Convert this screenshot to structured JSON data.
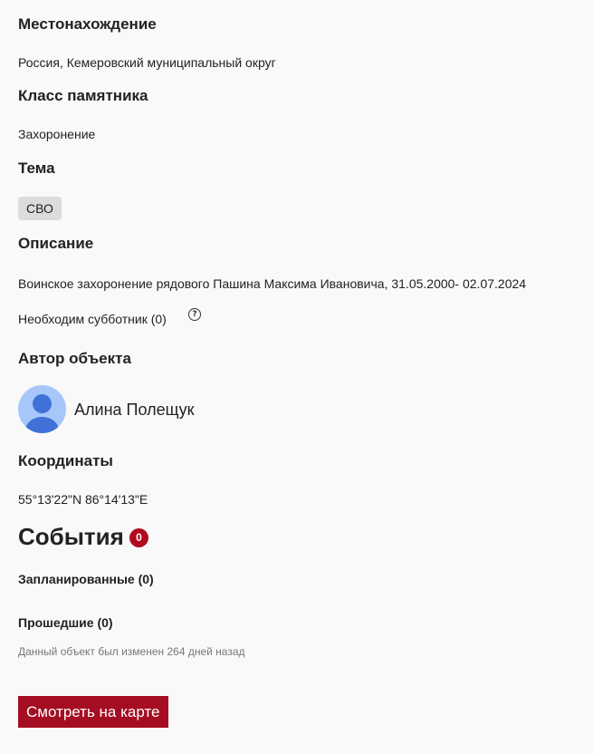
{
  "location": {
    "heading": "Местонахождение",
    "value": "Россия, Кемеровский муниципальный округ"
  },
  "monument_class": {
    "heading": "Класс памятника",
    "value": "Захоронение"
  },
  "topic": {
    "heading": "Тема",
    "tag": "СВО"
  },
  "description": {
    "heading": "Описание",
    "value": "Воинское захоронение рядового Пашина Максима Ивановича, 31.05.2000- 02.07.2024",
    "cleanup_text": "Необходим субботник (0)",
    "help_glyph": "?"
  },
  "author": {
    "heading": "Автор объекта",
    "name": "Алина Полещук"
  },
  "coordinates": {
    "heading": "Координаты",
    "value": "55°13'22\"N 86°14'13\"E"
  },
  "events": {
    "title": "События",
    "count": "0",
    "badge_color": "#b0091f",
    "planned": "Запланированные (0)",
    "past": "Прошедшие (0)"
  },
  "last_modified": "Данный объект был изменен 264 дней назад",
  "map_button": {
    "label": "Смотреть на карте",
    "color": "#a50d23"
  }
}
